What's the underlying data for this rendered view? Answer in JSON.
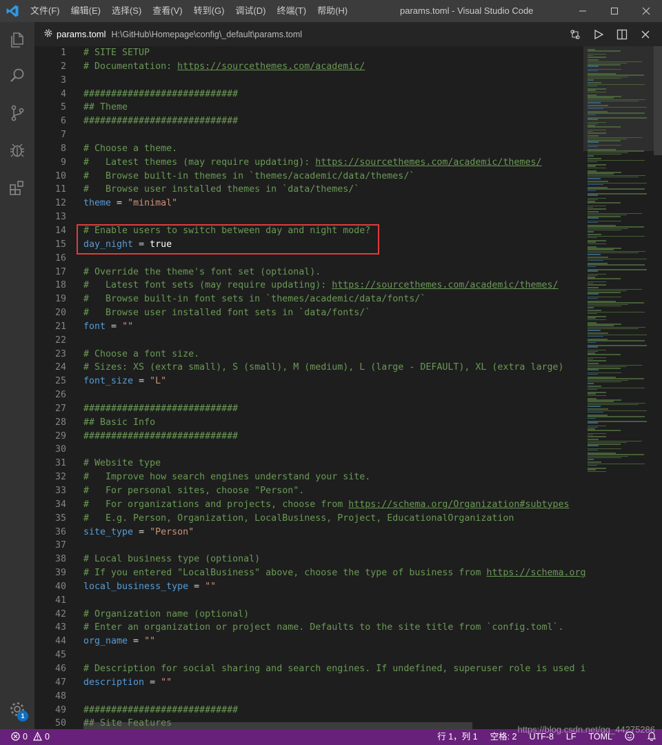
{
  "titlebar": {
    "menu": [
      "文件(F)",
      "编辑(E)",
      "选择(S)",
      "查看(V)",
      "转到(G)",
      "调试(D)",
      "终端(T)",
      "帮助(H)"
    ],
    "window_title": "params.toml - Visual Studio Code"
  },
  "activity_badge": "1",
  "tab": {
    "name": "params.toml",
    "path": "H:\\GitHub\\Homepage\\config\\_default\\params.toml"
  },
  "editor": {
    "line_numbers": [
      "1",
      "2",
      "3",
      "4",
      "5",
      "6",
      "7",
      "8",
      "9",
      "10",
      "11",
      "12",
      "13",
      "14",
      "15",
      "16",
      "17",
      "18",
      "19",
      "20",
      "21",
      "22",
      "23",
      "24",
      "25",
      "26",
      "27",
      "28",
      "29",
      "30",
      "31",
      "32",
      "33",
      "34",
      "35",
      "36",
      "37",
      "38",
      "39",
      "40",
      "41",
      "42",
      "43",
      "44",
      "45",
      "46",
      "47",
      "48",
      "49",
      "50"
    ],
    "lines": [
      [
        {
          "t": "# SITE SETUP",
          "c": "com"
        }
      ],
      [
        {
          "t": "# Documentation: ",
          "c": "com"
        },
        {
          "t": "https://sourcethemes.com/academic/",
          "c": "com url"
        }
      ],
      [],
      [
        {
          "t": "############################",
          "c": "com"
        }
      ],
      [
        {
          "t": "## Theme",
          "c": "com"
        }
      ],
      [
        {
          "t": "############################",
          "c": "com"
        }
      ],
      [],
      [
        {
          "t": "# Choose a theme.",
          "c": "com"
        }
      ],
      [
        {
          "t": "#   Latest themes (may require updating): ",
          "c": "com"
        },
        {
          "t": "https://sourcethemes.com/academic/themes/",
          "c": "com url"
        }
      ],
      [
        {
          "t": "#   Browse built-in themes in `themes/academic/data/themes/`",
          "c": "com"
        }
      ],
      [
        {
          "t": "#   Browse user installed themes in `data/themes/`",
          "c": "com"
        }
      ],
      [
        {
          "t": "theme",
          "c": "key"
        },
        {
          "t": " = ",
          "c": "plain"
        },
        {
          "t": "\"minimal\"",
          "c": "str"
        }
      ],
      [],
      [
        {
          "t": "# Enable users to switch between day and night mode?",
          "c": "com"
        }
      ],
      [
        {
          "t": "day_night",
          "c": "key"
        },
        {
          "t": " = ",
          "c": "plain"
        },
        {
          "t": "true",
          "c": "bool"
        }
      ],
      [],
      [
        {
          "t": "# Override the theme's font set (optional).",
          "c": "com"
        }
      ],
      [
        {
          "t": "#   Latest font sets (may require updating): ",
          "c": "com"
        },
        {
          "t": "https://sourcethemes.com/academic/themes/",
          "c": "com url"
        }
      ],
      [
        {
          "t": "#   Browse built-in font sets in `themes/academic/data/fonts/`",
          "c": "com"
        }
      ],
      [
        {
          "t": "#   Browse user installed font sets in `data/fonts/`",
          "c": "com"
        }
      ],
      [
        {
          "t": "font",
          "c": "key"
        },
        {
          "t": " = ",
          "c": "plain"
        },
        {
          "t": "\"\"",
          "c": "str"
        }
      ],
      [],
      [
        {
          "t": "# Choose a font size.",
          "c": "com"
        }
      ],
      [
        {
          "t": "# Sizes: XS (extra small), S (small), M (medium), L (large - DEFAULT), XL (extra large)",
          "c": "com"
        }
      ],
      [
        {
          "t": "font_size",
          "c": "key"
        },
        {
          "t": " = ",
          "c": "plain"
        },
        {
          "t": "\"L\"",
          "c": "str"
        }
      ],
      [],
      [
        {
          "t": "############################",
          "c": "com"
        }
      ],
      [
        {
          "t": "## Basic Info",
          "c": "com"
        }
      ],
      [
        {
          "t": "############################",
          "c": "com"
        }
      ],
      [],
      [
        {
          "t": "# Website type",
          "c": "com"
        }
      ],
      [
        {
          "t": "#   Improve how search engines understand your site.",
          "c": "com"
        }
      ],
      [
        {
          "t": "#   For personal sites, choose \"Person\".",
          "c": "com"
        }
      ],
      [
        {
          "t": "#   For organizations and projects, choose from ",
          "c": "com"
        },
        {
          "t": "https://schema.org/Organization#subtypes",
          "c": "com url"
        }
      ],
      [
        {
          "t": "#   E.g. Person, Organization, LocalBusiness, Project, EducationalOrganization",
          "c": "com"
        }
      ],
      [
        {
          "t": "site_type",
          "c": "key"
        },
        {
          "t": " = ",
          "c": "plain"
        },
        {
          "t": "\"Person\"",
          "c": "str"
        }
      ],
      [],
      [
        {
          "t": "# Local business type (optional)",
          "c": "com"
        }
      ],
      [
        {
          "t": "# If you entered \"LocalBusiness\" above, choose the type of business from ",
          "c": "com"
        },
        {
          "t": "https://schema.org",
          "c": "com url"
        }
      ],
      [
        {
          "t": "local_business_type",
          "c": "key"
        },
        {
          "t": " = ",
          "c": "plain"
        },
        {
          "t": "\"\"",
          "c": "str"
        }
      ],
      [],
      [
        {
          "t": "# Organization name (optional)",
          "c": "com"
        }
      ],
      [
        {
          "t": "# Enter an organization or project name. Defaults to the site title from `config.toml`.",
          "c": "com"
        }
      ],
      [
        {
          "t": "org_name",
          "c": "key"
        },
        {
          "t": " = ",
          "c": "plain"
        },
        {
          "t": "\"\"",
          "c": "str"
        }
      ],
      [],
      [
        {
          "t": "# Description for social sharing and search engines. If undefined, superuser role is used i",
          "c": "com"
        }
      ],
      [
        {
          "t": "description",
          "c": "key"
        },
        {
          "t": " = ",
          "c": "plain"
        },
        {
          "t": "\"\"",
          "c": "str"
        }
      ],
      [],
      [
        {
          "t": "############################",
          "c": "com"
        }
      ],
      [
        {
          "t": "## Site Features",
          "c": "com"
        }
      ]
    ]
  },
  "statusbar": {
    "errors": "0",
    "warnings": "0",
    "position": "行 1，列 1",
    "indent": "空格: 2",
    "encoding": "UTF-8",
    "eol": "LF",
    "language": "TOML"
  },
  "watermark": "https://blog.csdn.net/qq_44275286",
  "colors": {
    "statusbar": "#68217a",
    "highlight_box": "#e03c3c",
    "comment": "#6a9955",
    "keyword": "#569cd6",
    "string": "#ce9178"
  }
}
